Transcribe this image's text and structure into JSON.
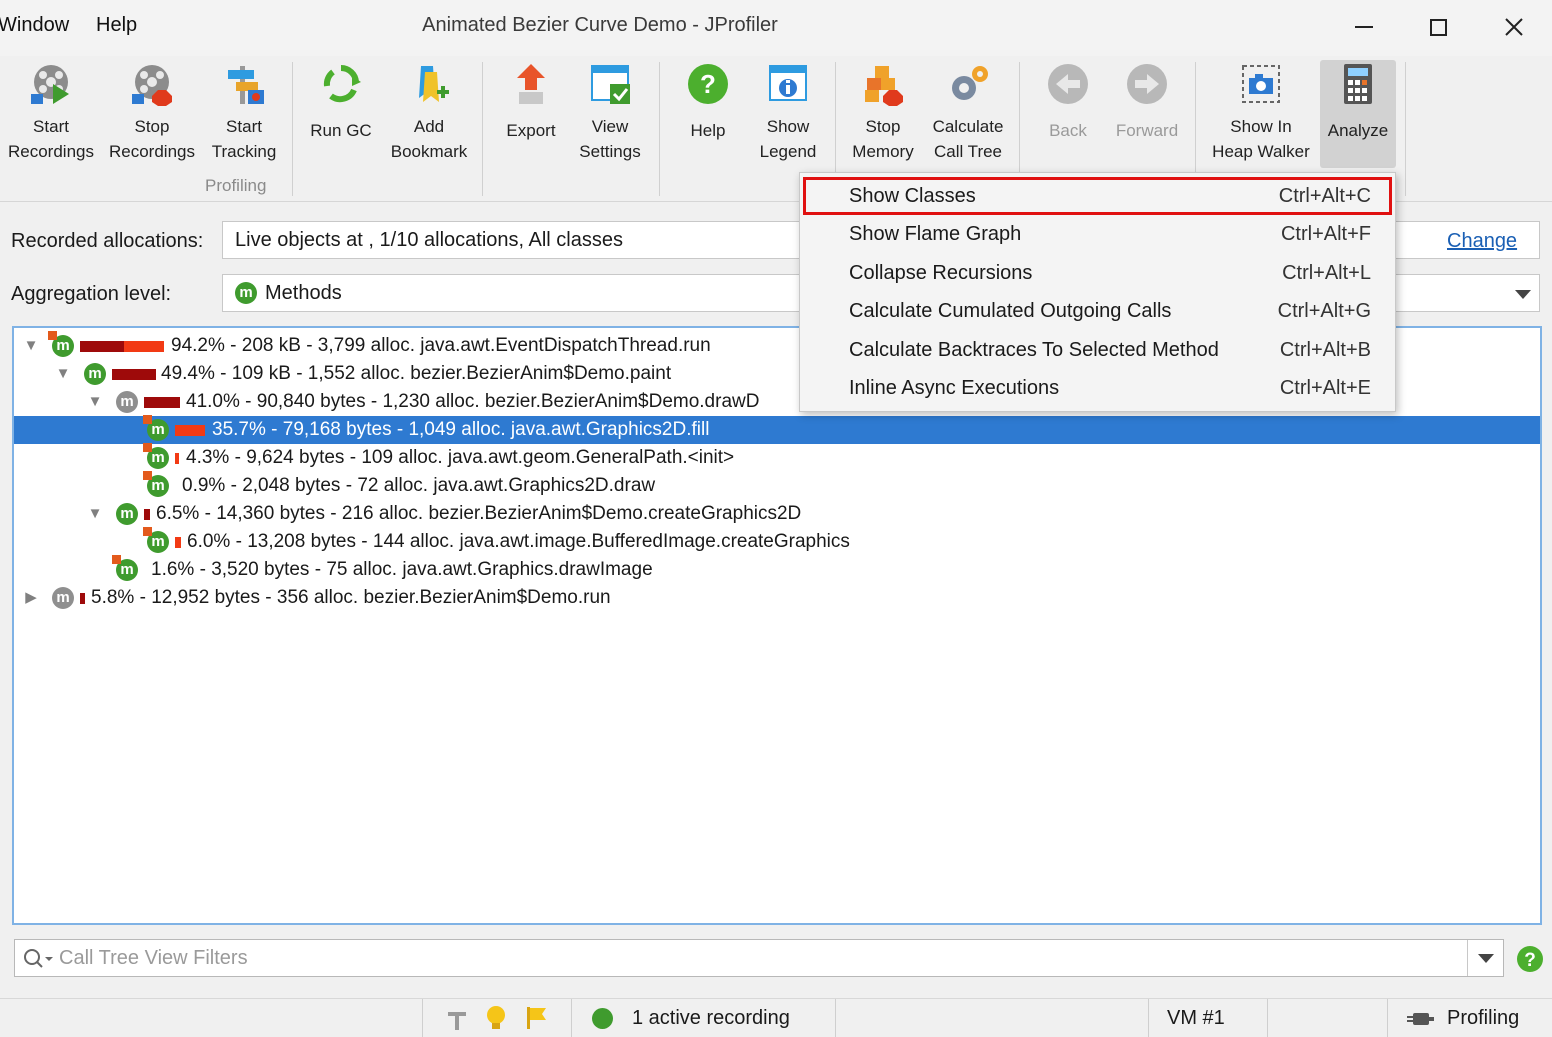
{
  "window": {
    "title": "Animated Bezier Curve Demo - JProfiler",
    "menu": [
      "Window",
      "Help"
    ]
  },
  "toolbar": {
    "buttons": [
      {
        "line1": "Start",
        "line2": "Recordings",
        "icon": "film-reel-play-icon"
      },
      {
        "line1": "Stop",
        "line2": "Recordings",
        "icon": "film-reel-stop-icon"
      },
      {
        "line1": "Start",
        "line2": "Tracking",
        "icon": "tracking-icon"
      },
      {
        "line1": "Run GC",
        "line2": "",
        "icon": "recycle-icon"
      },
      {
        "line1": "Add",
        "line2": "Bookmark",
        "icon": "bookmark-add-icon"
      },
      {
        "line1": "Export",
        "line2": "",
        "icon": "export-arrow-icon"
      },
      {
        "line1": "View",
        "line2": "Settings",
        "icon": "view-settings-icon"
      },
      {
        "line1": "Help",
        "line2": "",
        "icon": "help-icon"
      },
      {
        "line1": "Show",
        "line2": "Legend",
        "icon": "legend-icon"
      },
      {
        "line1": "Stop",
        "line2": "Memory",
        "icon": "stop-memory-icon"
      },
      {
        "line1": "Calculate",
        "line2": "Call Tree",
        "icon": "gears-icon"
      },
      {
        "line1": "Back",
        "line2": "",
        "icon": "back-arrow-icon"
      },
      {
        "line1": "Forward",
        "line2": "",
        "icon": "forward-arrow-icon"
      },
      {
        "line1": "Show In",
        "line2": "Heap Walker",
        "icon": "camera-icon"
      },
      {
        "line1": "Analyze",
        "line2": "",
        "icon": "calculator-icon"
      }
    ],
    "group_label": "Profiling"
  },
  "form": {
    "recorded_label": "Recorded allocations:",
    "recorded_value": "Live objects at  , 1/10 allocations, All classes",
    "change_link": "Change",
    "aggregation_label": "Aggregation level:",
    "aggregation_value": "Methods"
  },
  "tree": {
    "rows": [
      {
        "text": "94.2% - 208 kB - 3,799 alloc. java.awt.EventDispatchThread.run"
      },
      {
        "text": "49.4% - 109 kB - 1,552 alloc. bezier.BezierAnim$Demo.paint"
      },
      {
        "text": "41.0% - 90,840 bytes - 1,230 alloc. bezier.BezierAnim$Demo.drawD"
      },
      {
        "text": "35.7% - 79,168 bytes - 1,049 alloc. java.awt.Graphics2D.fill"
      },
      {
        "text": "4.3% - 9,624 bytes - 109 alloc. java.awt.geom.GeneralPath.<init>"
      },
      {
        "text": "0.9% - 2,048 bytes - 72 alloc. java.awt.Graphics2D.draw"
      },
      {
        "text": "6.5% - 14,360 bytes - 216 alloc. bezier.BezierAnim$Demo.createGraphics2D"
      },
      {
        "text": "6.0% - 13,208 bytes - 144 alloc. java.awt.image.BufferedImage.createGraphics"
      },
      {
        "text": "1.6% - 3,520 bytes - 75 alloc. java.awt.Graphics.drawImage"
      },
      {
        "text": "5.8% - 12,952 bytes - 356 alloc. bezier.BezierAnim$Demo.run"
      }
    ]
  },
  "popup": {
    "items": [
      {
        "label": "Show Classes",
        "shortcut": "Ctrl+Alt+C"
      },
      {
        "label": "Show Flame Graph",
        "shortcut": "Ctrl+Alt+F"
      },
      {
        "label": "Collapse Recursions",
        "shortcut": "Ctrl+Alt+L"
      },
      {
        "label": "Calculate Cumulated Outgoing Calls",
        "shortcut": "Ctrl+Alt+G"
      },
      {
        "label": "Calculate Backtraces To Selected Method",
        "shortcut": "Ctrl+Alt+B"
      },
      {
        "label": "Inline Async Executions",
        "shortcut": "Ctrl+Alt+E"
      }
    ]
  },
  "filter": {
    "placeholder": "Call Tree View Filters"
  },
  "status": {
    "recording": "1 active recording",
    "vm": "VM #1",
    "mode": "Profiling"
  },
  "colors": {
    "accent": "#2e7ad1",
    "highlight": "#e01010",
    "method_icon": "#3f9b2e"
  }
}
